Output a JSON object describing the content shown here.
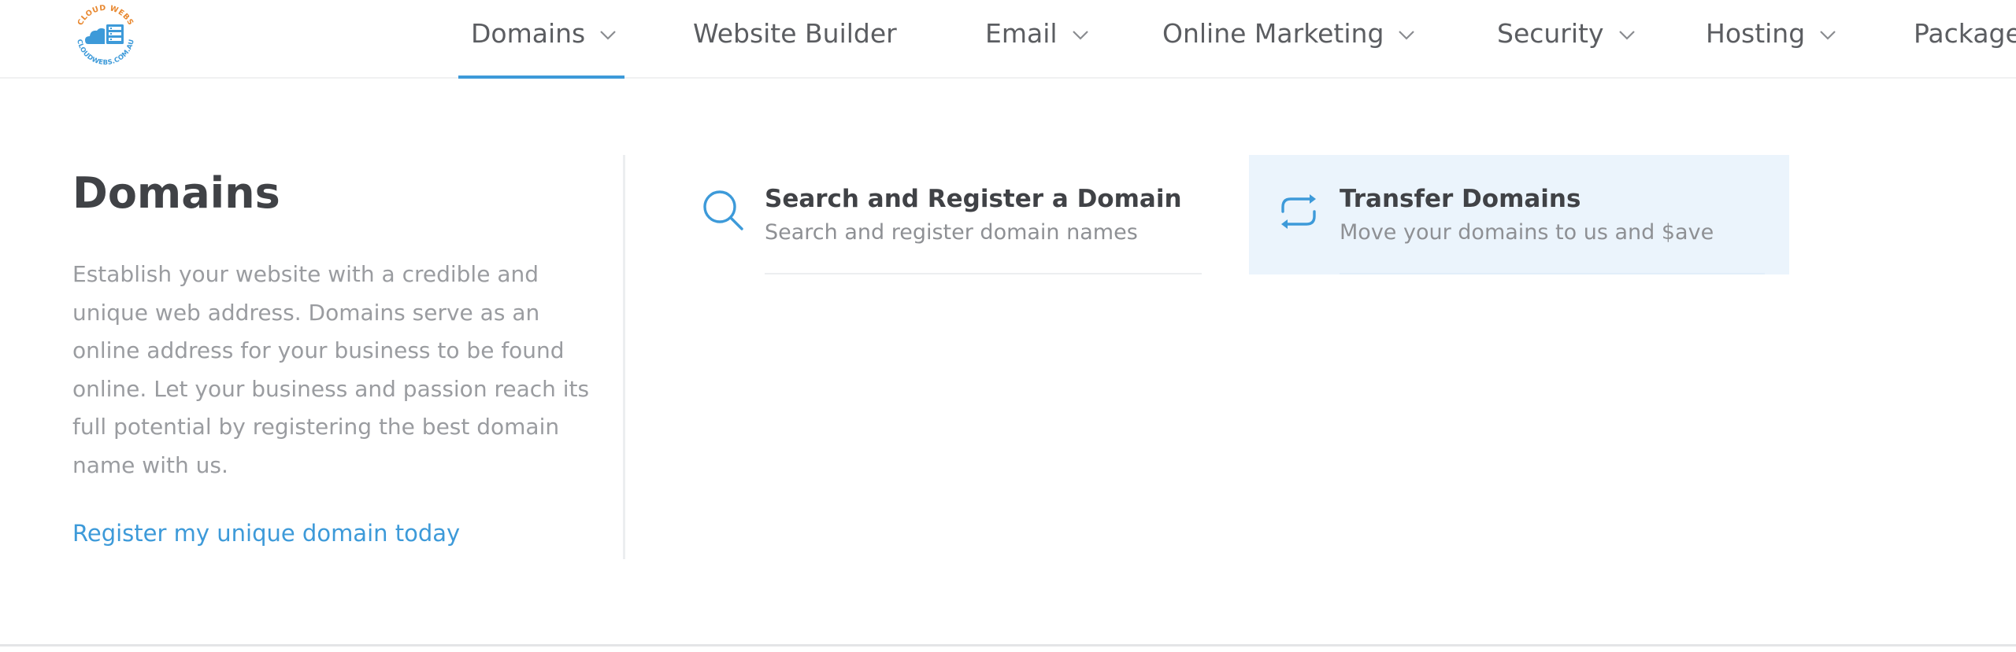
{
  "logo": {
    "top_text": "CLOUD WEBS",
    "bottom_text": "CLOUDWEBS.COM.AU",
    "colors": {
      "orange": "#e8872e",
      "blue": "#3d9ad9"
    }
  },
  "nav": {
    "items": [
      {
        "label": "Domains",
        "has_dropdown": true,
        "active": true
      },
      {
        "label": "Website Builder",
        "has_dropdown": false
      },
      {
        "label": "Email",
        "has_dropdown": true
      },
      {
        "label": "Online Marketing",
        "has_dropdown": true
      },
      {
        "label": "Security",
        "has_dropdown": true
      },
      {
        "label": "Hosting",
        "has_dropdown": true
      },
      {
        "label": "Packages",
        "has_dropdown": false
      }
    ]
  },
  "mega_menu": {
    "title": "Domains",
    "description": "Establish your website with a credible and unique web address. Domains serve as an online address for your business to be found online. Let your business and passion reach its full potential by registering the best domain name with us.",
    "cta_link": "Register my unique domain today",
    "cards": [
      {
        "icon": "search-icon",
        "title": "Search and Register a Domain",
        "subtitle": "Search and register domain names",
        "highlighted": false
      },
      {
        "icon": "transfer-icon",
        "title": "Transfer Domains",
        "subtitle": "Move your domains to us and $ave",
        "highlighted": true
      }
    ]
  },
  "colors": {
    "accent": "#3d9ad9",
    "heading": "#404246",
    "nav_text": "#5b5d61",
    "muted_text": "#9a9ca0",
    "highlight_bg": "#ebf4fc"
  }
}
